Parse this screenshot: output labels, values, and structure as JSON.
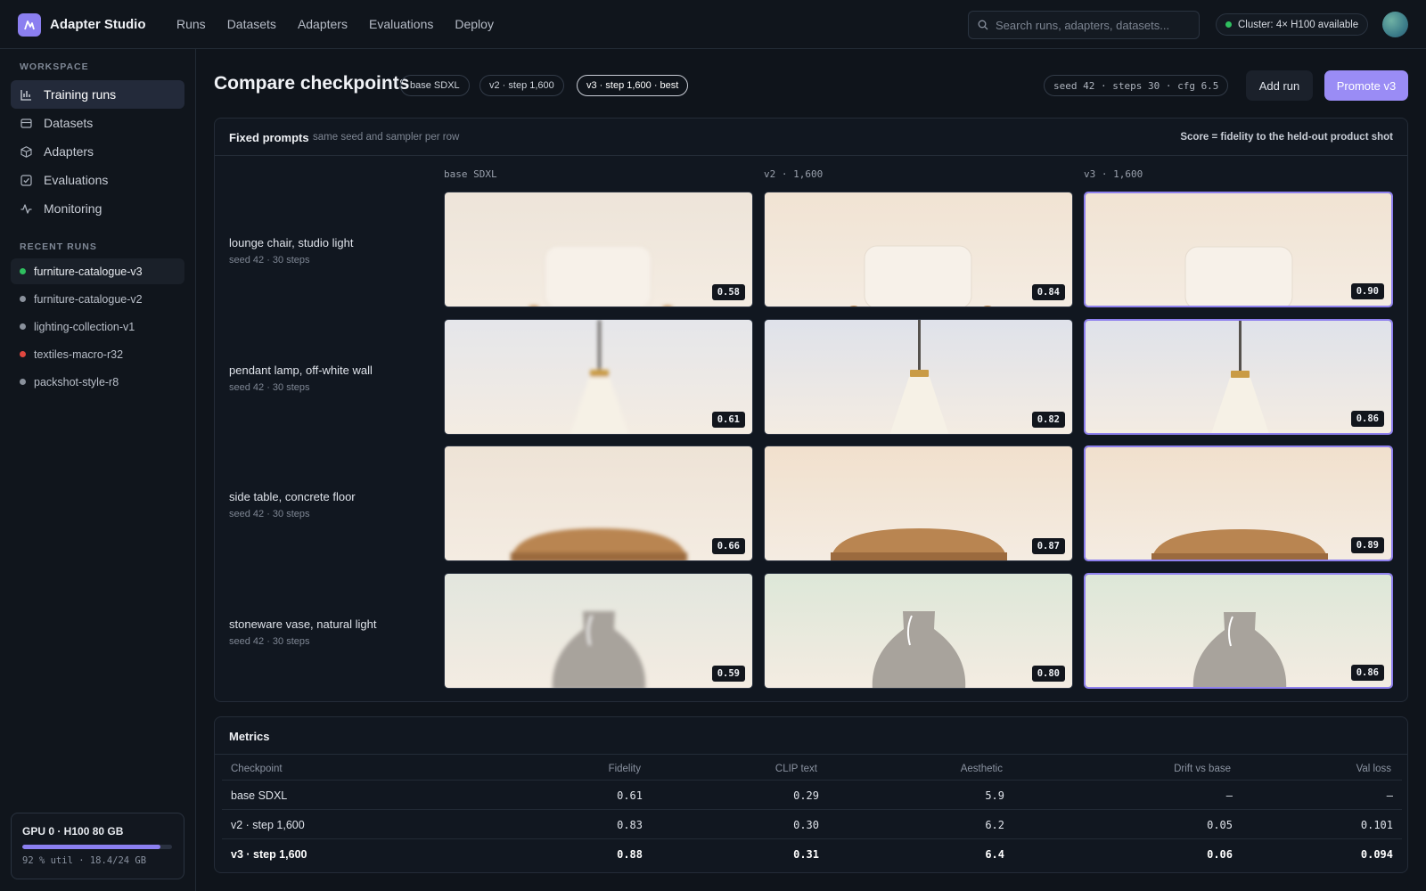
{
  "app": {
    "title": "Adapter Studio",
    "logo_color": "#8b7ff0"
  },
  "nav": [
    "Runs",
    "Datasets",
    "Adapters",
    "Evaluations",
    "Deploy"
  ],
  "search": {
    "placeholder": "Search runs, adapters, datasets..."
  },
  "cluster": {
    "label": "Cluster: 4× H100 available",
    "status_color": "#2fbf5f"
  },
  "sidebar": {
    "workspace_label": "WORKSPACE",
    "items": [
      {
        "label": "Training runs",
        "icon": "bar-chart-icon",
        "active": true
      },
      {
        "label": "Datasets",
        "icon": "table-icon"
      },
      {
        "label": "Adapters",
        "icon": "cube-icon"
      },
      {
        "label": "Evaluations",
        "icon": "checkbox-icon"
      },
      {
        "label": "Monitoring",
        "icon": "pulse-icon"
      }
    ],
    "recent_label": "RECENT RUNS",
    "recent_runs": [
      {
        "label": "furniture-catalogue-v3",
        "color": "#2fbf5f",
        "active": true
      },
      {
        "label": "furniture-catalogue-v2",
        "color": "#8a919c"
      },
      {
        "label": "lighting-collection-v1",
        "color": "#8a919c"
      },
      {
        "label": "textiles-macro-r32",
        "color": "#e0473f"
      },
      {
        "label": "packshot-style-r8",
        "color": "#8a919c"
      }
    ],
    "gpu": {
      "title": "GPU 0 · H100 80 GB",
      "utilization": 0.92,
      "sub": "92 % util · 18.4/24 GB"
    }
  },
  "header": {
    "title": "Compare checkpoints",
    "chips": [
      "base SDXL",
      "v2 · step 1,600",
      "v3 · step 1,600 · best"
    ],
    "seed_info": "seed 42 · steps 30 · cfg 6.5",
    "add_run_label": "Add run",
    "promote_label": "Promote v3"
  },
  "prompts_panel": {
    "title": "Fixed prompts",
    "subtitle": "same seed and sampler per row",
    "score_note": "Score = fidelity to the held-out product shot",
    "columns": [
      "base SDXL",
      "v2 · 1,600",
      "v3 · 1,600"
    ],
    "rows": [
      {
        "prompt": "lounge chair, studio light",
        "meta": "seed 42 · 30 steps",
        "kind": "chair",
        "scores": [
          "0.58",
          "0.84",
          "0.90"
        ]
      },
      {
        "prompt": "pendant lamp, off-white wall",
        "meta": "seed 42 · 30 steps",
        "kind": "lamp",
        "scores": [
          "0.61",
          "0.82",
          "0.86"
        ]
      },
      {
        "prompt": "side table, concrete floor",
        "meta": "seed 42 · 30 steps",
        "kind": "table",
        "scores": [
          "0.66",
          "0.87",
          "0.89"
        ]
      },
      {
        "prompt": "stoneware vase, natural light",
        "meta": "seed 42 · 30 steps",
        "kind": "vase",
        "scores": [
          "0.59",
          "0.80",
          "0.86"
        ]
      }
    ]
  },
  "metrics": {
    "title": "Metrics",
    "headers": [
      "Checkpoint",
      "Fidelity",
      "CLIP text",
      "Aesthetic",
      "Drift vs base",
      "Val loss"
    ],
    "rows": [
      [
        "base SDXL",
        "0.61",
        "0.29",
        "5.9",
        "—",
        "—"
      ],
      [
        "v2 · step 1,600",
        "0.83",
        "0.30",
        "6.2",
        "0.05",
        "0.101"
      ],
      [
        "v3 · step 1,600",
        "0.88",
        "0.31",
        "6.4",
        "0.06",
        "0.094"
      ]
    ]
  }
}
